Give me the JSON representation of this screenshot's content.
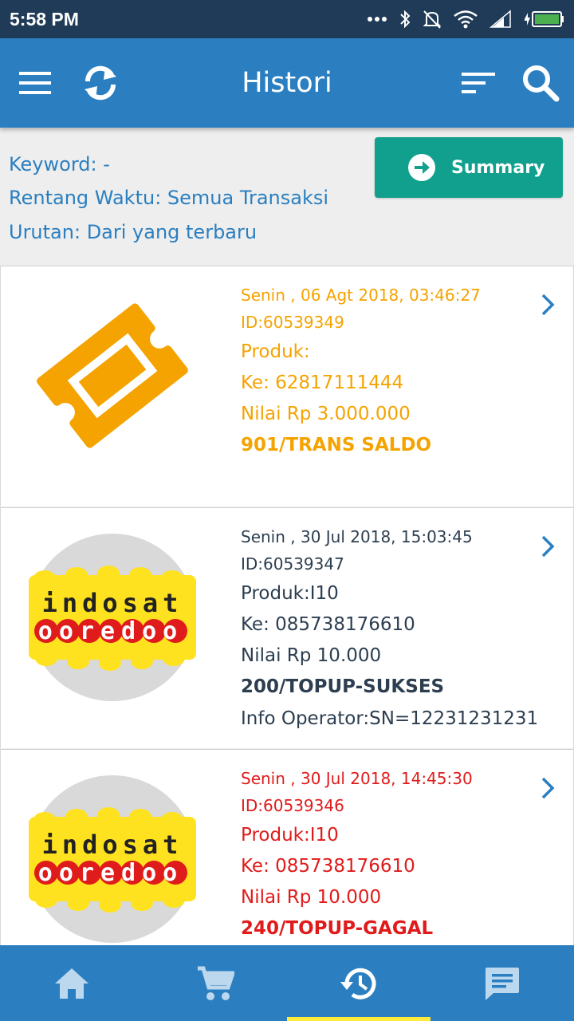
{
  "status_bar": {
    "time": "5:58 PM"
  },
  "app_bar": {
    "title": "Histori"
  },
  "filter": {
    "keyword": "Keyword: -",
    "range": "Rentang Waktu: Semua Transaksi",
    "order": "Urutan: Dari yang terbaru",
    "summary_label": "Summary"
  },
  "transactions": [
    {
      "icon": "ticket-icon",
      "color": "#f5a300",
      "date": "Senin , 06 Agt 2018, 03:46:27",
      "id": "ID:60539349",
      "product": "Produk:",
      "to": "Ke: 62817111444",
      "value": "Nilai Rp 3.000.000",
      "status": "901/TRANS SALDO",
      "info": ""
    },
    {
      "icon": "indosat-ooredoo-logo",
      "color": "#2c3e50",
      "date": "Senin , 30 Jul 2018, 15:03:45",
      "id": "ID:60539347",
      "product": "Produk:I10",
      "to": "Ke: 085738176610",
      "value": "Nilai Rp 10.000",
      "status": "200/TOPUP-SUKSES",
      "info": "Info Operator:SN=12231231231"
    },
    {
      "icon": "indosat-ooredoo-logo",
      "color": "#e01b1b",
      "date": "Senin , 30 Jul 2018, 14:45:30",
      "id": "ID:60539346",
      "product": "Produk:I10",
      "to": "Ke: 085738176610",
      "value": "Nilai Rp 10.000",
      "status": "240/TOPUP-GAGAL",
      "info": ""
    }
  ],
  "logo": {
    "top": "indosat",
    "bottom": "ooredoo"
  },
  "bottom_nav": {
    "items": [
      "home-icon",
      "cart-icon",
      "history-icon",
      "chat-icon"
    ],
    "active": "history-icon"
  },
  "colors": {
    "primary": "#2b7fc0",
    "status_bar": "#1f3b57",
    "accent": "#11a08e",
    "active_indicator": "#ffeb3b"
  }
}
